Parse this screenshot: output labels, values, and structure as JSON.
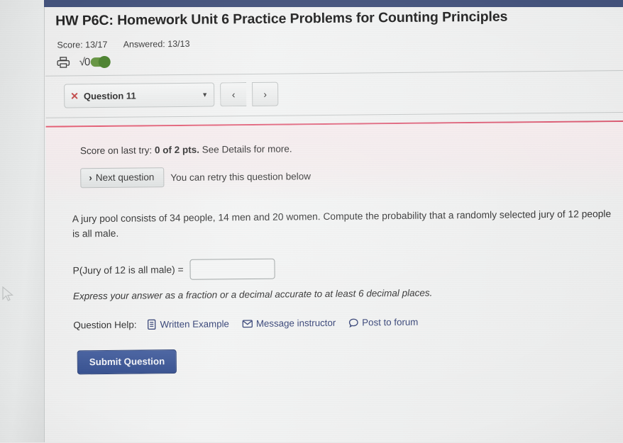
{
  "header": {
    "title": "HW P6C: Homework Unit 6 Practice Problems for Counting Principles",
    "score_label": "Score: 13/17",
    "answered_label": "Answered: 13/13",
    "print_icon": "printer-icon",
    "sqrt_glyph": "√0",
    "equation_toggle_icon": "toggle-switch-on"
  },
  "question_nav": {
    "status_icon": "x-mark-icon",
    "question_label": "Question 11",
    "caret_icon": "chevron-down-icon",
    "prev_label": "‹",
    "next_label": "›"
  },
  "feedback": {
    "score_prefix": "Score on last try: ",
    "score_value": "0 of 2 pts.",
    "score_suffix": " See Details for more.",
    "next_question_label": "Next question",
    "next_question_chevron": "›",
    "retry_note": "You can retry this question below"
  },
  "question": {
    "body": "A jury pool consists of 34 people, 14 men and 20 women. Compute the probability that a randomly selected jury of 12 people is all male.",
    "answer_prompt": "P(Jury of 12 is all male) =",
    "answer_value": "",
    "answer_placeholder": "",
    "answer_note": "Express your answer as a fraction or a decimal accurate to at least 6 decimal places."
  },
  "help": {
    "label": "Question Help:",
    "links": [
      {
        "label": "Written Example",
        "icon": "document-icon"
      },
      {
        "label": "Message instructor",
        "icon": "envelope-icon"
      },
      {
        "label": "Post to forum",
        "icon": "speech-bubble-icon"
      }
    ]
  },
  "actions": {
    "submit_label": "Submit Question"
  },
  "colors": {
    "accent_blue": "#3b5590",
    "alert_red": "#dd5569",
    "toggle_green": "#49802c",
    "link_navy": "#2f3d72",
    "chrome_navy": "#44537c"
  }
}
